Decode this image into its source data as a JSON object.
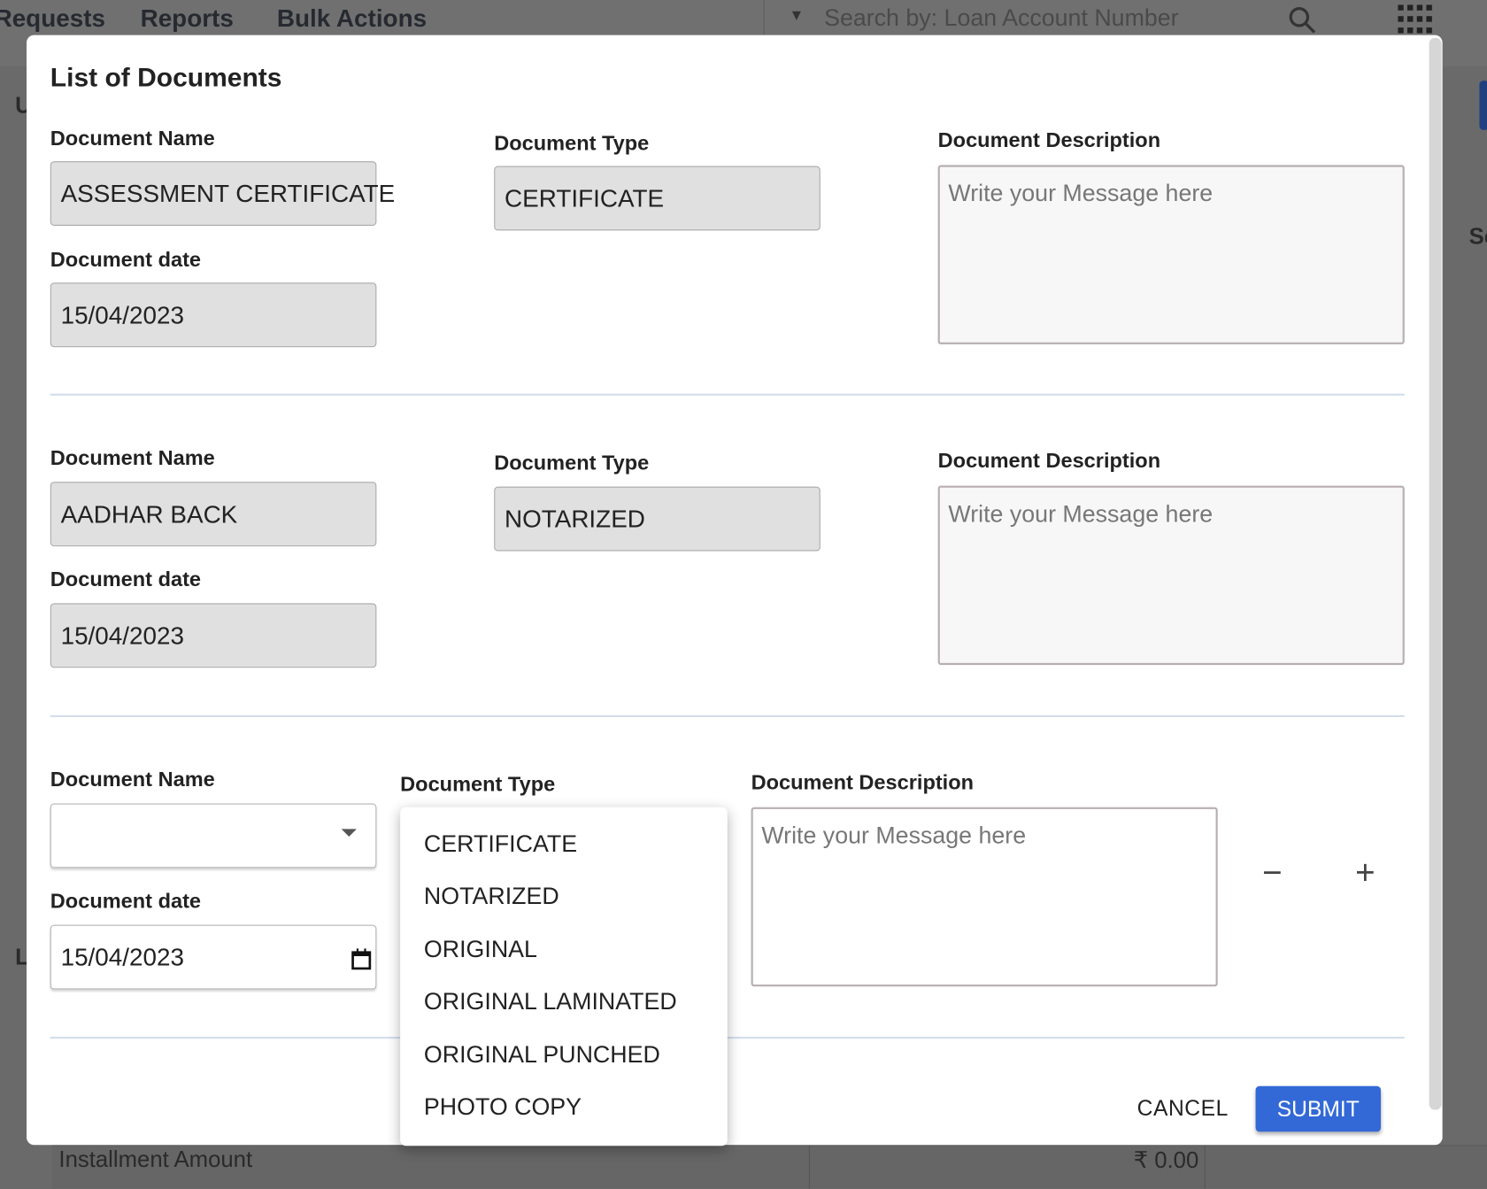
{
  "nav": {
    "items": [
      "Requests",
      "Reports",
      "Bulk Actions"
    ],
    "search_placeholder": "Search by: Loan Account Number"
  },
  "background": {
    "row_label": "Installment Amount",
    "row_value": "₹ 0.00",
    "partial_u": "U",
    "partial_sc": "Sc",
    "partial_l": "L"
  },
  "modal": {
    "title": "List of Documents",
    "labels": {
      "name": "Document Name",
      "type": "Document Type",
      "description": "Document Description",
      "date": "Document date"
    },
    "description_placeholder": "Write your Message here",
    "documents": [
      {
        "name": "ASSESSMENT CERTIFICATE",
        "type": "CERTIFICATE",
        "date": "15/04/2023",
        "description": ""
      },
      {
        "name": "AADHAR BACK",
        "type": "NOTARIZED",
        "date": "15/04/2023",
        "description": ""
      },
      {
        "name": "",
        "type": "",
        "date": "15/04/2023",
        "description": ""
      }
    ],
    "type_options": [
      "CERTIFICATE",
      "NOTARIZED",
      "ORIGINAL",
      "ORIGINAL LAMINATED",
      "ORIGINAL PUNCHED",
      "PHOTO COPY"
    ],
    "remove_label": "−",
    "add_label": "+",
    "cancel_label": "CANCEL",
    "submit_label": "SUBMIT",
    "accent_color": "#3369d6"
  }
}
